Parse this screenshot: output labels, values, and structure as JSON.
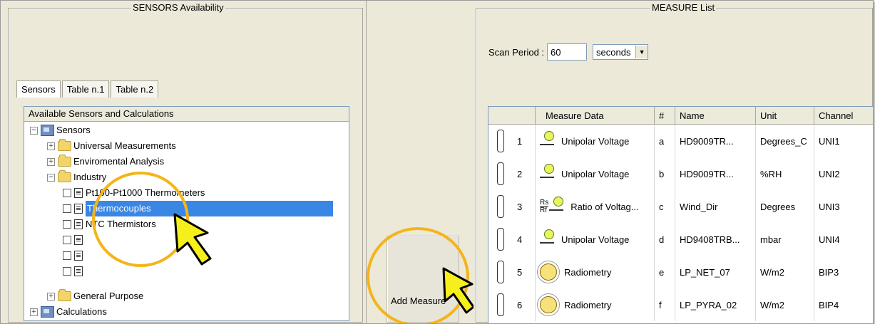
{
  "sensors_panel": {
    "title": "SENSORS Availability",
    "tabs": [
      "Sensors",
      "Table n.1",
      "Table n.2"
    ],
    "tree_header": "Available Sensors and Calculations",
    "nodes": [
      {
        "label": "Sensors",
        "expander": "−",
        "icon": "book-icon"
      },
      {
        "label": "Universal Measurements",
        "expander": "+",
        "icon": "folder-icon"
      },
      {
        "label": "Enviromental Analysis",
        "expander": "+",
        "icon": "folder-icon"
      },
      {
        "label": "Industry",
        "expander": "−",
        "icon": "folder-icon"
      },
      {
        "label": "Pt100-Pt1000 Thermometers",
        "icon": "document-icon"
      },
      {
        "label": "Thermocouples",
        "icon": "document-icon",
        "selected": true
      },
      {
        "label": "NTC Thermistors",
        "icon": "document-icon"
      },
      {
        "label": "",
        "icon": "document-icon"
      },
      {
        "label": "",
        "icon": "document-icon"
      },
      {
        "label": "",
        "icon": "document-icon"
      },
      {
        "label": "General Purpose",
        "expander": "+",
        "icon": "folder-icon"
      },
      {
        "label": "Calculations",
        "expander": "+",
        "icon": "book-icon"
      }
    ]
  },
  "add_button": {
    "label": "Add Measure"
  },
  "measure_panel": {
    "title": "MEASURE List",
    "scan_label": "Scan Period :",
    "scan_value": "60",
    "unit_option": "seconds",
    "columns": [
      "Measure Data",
      "#",
      "Name",
      "Unit",
      "Channel"
    ],
    "rows": [
      {
        "num": "1",
        "icon": "unipolar-voltage-icon",
        "data": "Unipolar Voltage",
        "id": "a",
        "name": "HD9009TR...",
        "unit": "Degrees_C",
        "channel": "UNI1"
      },
      {
        "num": "2",
        "icon": "unipolar-voltage-icon",
        "data": "Unipolar Voltage",
        "id": "b",
        "name": "HD9009TR...",
        "unit": "%RH",
        "channel": "UNI2"
      },
      {
        "num": "3",
        "icon": "ratio-voltage-icon",
        "data": "Ratio of Voltag...",
        "id": "c",
        "name": "Wind_Dir",
        "unit": "Degrees",
        "channel": "UNI3"
      },
      {
        "num": "4",
        "icon": "unipolar-voltage-icon",
        "data": "Unipolar Voltage",
        "id": "d",
        "name": "HD9408TRB...",
        "unit": "mbar",
        "channel": "UNI4"
      },
      {
        "num": "5",
        "icon": "lightbulb-icon",
        "data": "Radiometry",
        "id": "e",
        "name": "LP_NET_07",
        "unit": "W/m2",
        "channel": "BIP3"
      },
      {
        "num": "6",
        "icon": "lightbulb-icon",
        "data": "Radiometry",
        "id": "f",
        "name": "LP_PYRA_02",
        "unit": "W/m2",
        "channel": "BIP4"
      }
    ],
    "ratio_symbol": {
      "top": "Rs",
      "bottom": "Rf"
    }
  },
  "colors": {
    "highlight": "#3a86e4",
    "annotation_ring": "#f4b41a",
    "cursor": "#f6ef1c",
    "arrow": "#4fbf3a"
  }
}
